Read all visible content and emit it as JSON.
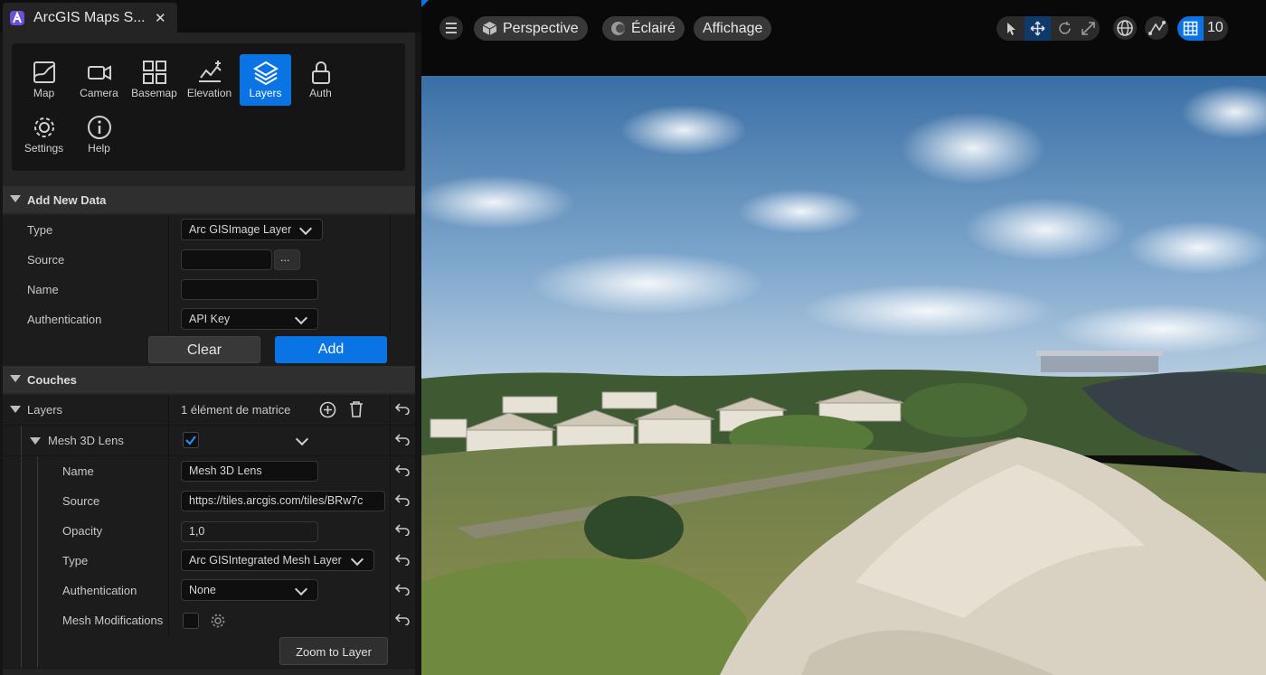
{
  "window": {
    "tab_title": "ArcGIS Maps S...",
    "close_glyph": "✕"
  },
  "tools": [
    {
      "label": "Map",
      "icon": "map-icon"
    },
    {
      "label": "Camera",
      "icon": "camera-icon"
    },
    {
      "label": "Basemap",
      "icon": "basemap-icon"
    },
    {
      "label": "Elevation",
      "icon": "elevation-icon"
    },
    {
      "label": "Layers",
      "icon": "layers-icon",
      "active": true
    },
    {
      "label": "Auth",
      "icon": "lock-icon"
    },
    {
      "label": "Settings",
      "icon": "gear-icon"
    },
    {
      "label": "Help",
      "icon": "info-icon"
    }
  ],
  "add_new_data": {
    "header": "Add New Data",
    "type_label": "Type",
    "type_value": "Arc GISImage Layer",
    "source_label": "Source",
    "source_value": "",
    "browse_label": "...",
    "name_label": "Name",
    "name_value": "",
    "auth_label": "Authentication",
    "auth_value": "API Key",
    "clear_label": "Clear",
    "add_label": "Add"
  },
  "couches": {
    "header": "Couches",
    "layers_label": "Layers",
    "layers_count": "1 élément de matrice",
    "item": {
      "label": "Mesh 3D Lens",
      "checked": true,
      "name_label": "Name",
      "name_value": "Mesh 3D Lens",
      "source_label": "Source",
      "source_value": "https://tiles.arcgis.com/tiles/BRw7c",
      "opacity_label": "Opacity",
      "opacity_value": "1,0",
      "type_label": "Type",
      "type_value": "Arc GISIntegrated Mesh Layer",
      "auth_label": "Authentication",
      "auth_value": "None",
      "mesh_mod_label": "Mesh Modifications",
      "zoom_label": "Zoom to Layer"
    }
  },
  "viewport": {
    "perspective": "Perspective",
    "lit": "Éclairé",
    "show": "Affichage",
    "grid_value": "10"
  },
  "colors": {
    "accent": "#0a74e5",
    "panel": "#242424",
    "row": "#1c1c1c"
  }
}
